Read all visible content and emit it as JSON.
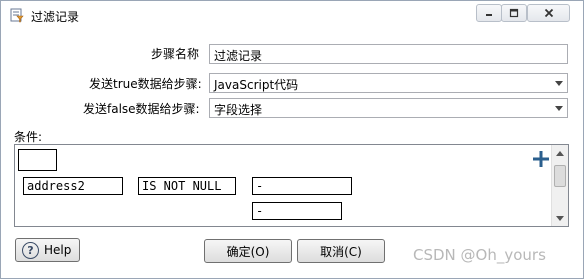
{
  "window": {
    "title": "过滤记录",
    "icon": "filter-rows-icon"
  },
  "form": {
    "step_name_label": "步骤名称",
    "step_name_value": "过滤记录",
    "send_true_label": "发送true数据给步骤:",
    "send_true_value": "JavaScript代码",
    "send_false_label": "发送false数据给步骤:",
    "send_false_value": "字段选择"
  },
  "conditions": {
    "label": "条件:",
    "field": "address2",
    "operator": "IS NOT NULL",
    "value1": "-",
    "value2": "-"
  },
  "buttons": {
    "help": "Help",
    "ok": "确定(O)",
    "cancel": "取消(C)"
  },
  "watermark": "CSDN @Oh_yours"
}
